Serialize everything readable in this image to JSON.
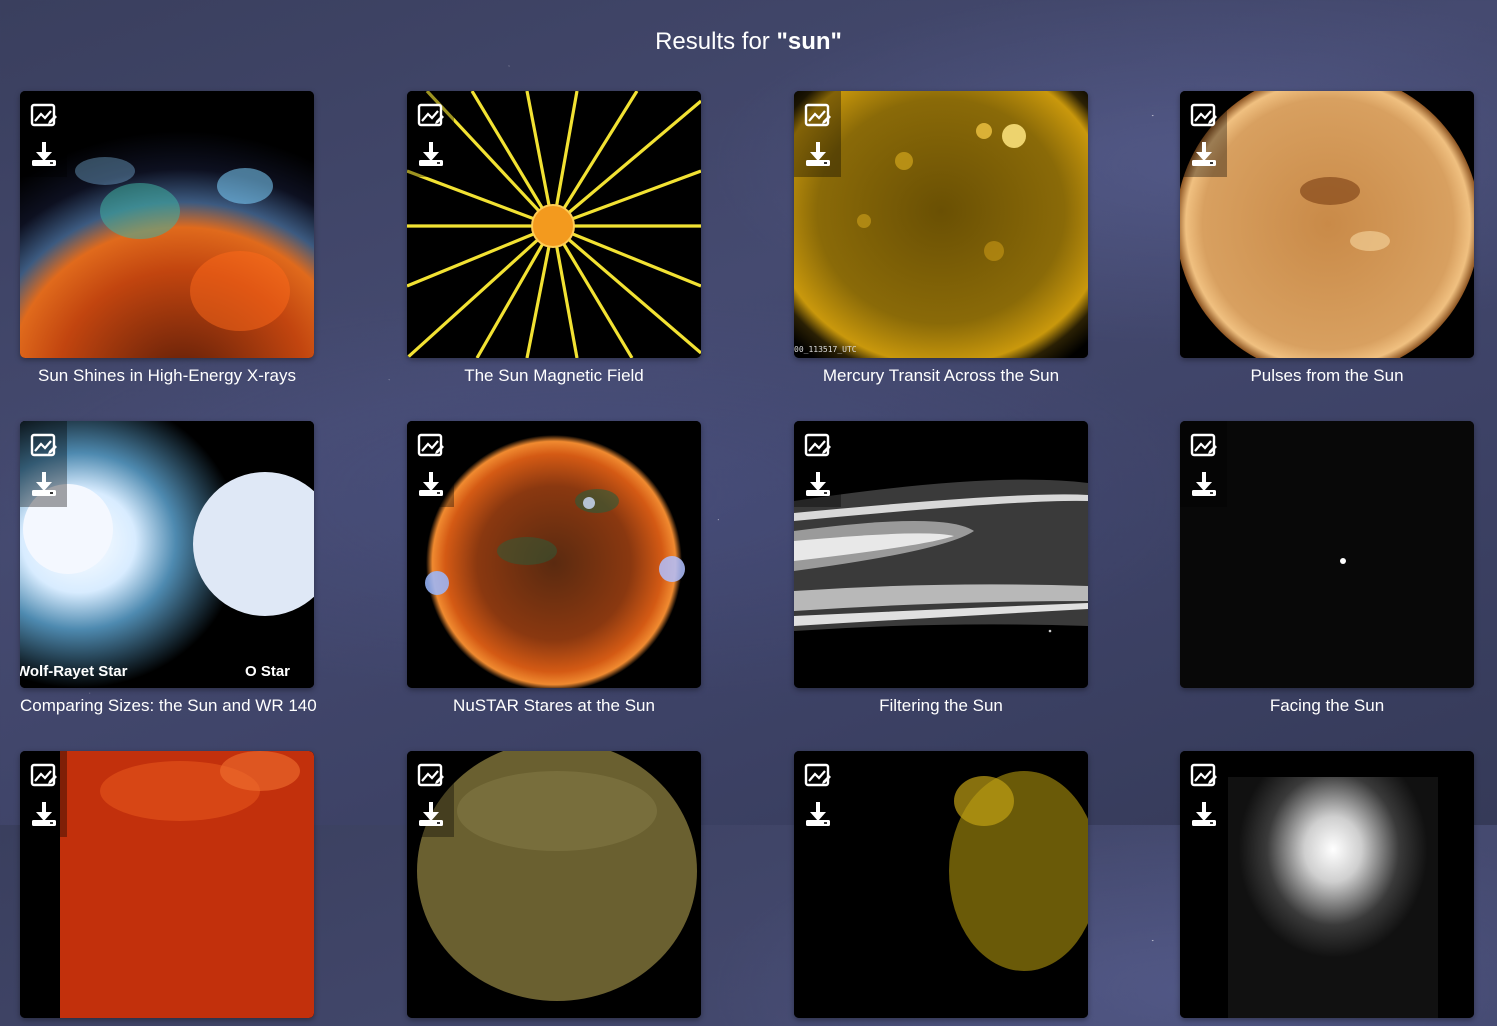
{
  "header": {
    "title_prefix": "Results for ",
    "query": "\"sun\""
  },
  "tool_labels": {
    "view": "",
    "download": ""
  },
  "results": [
    {
      "caption": "Sun Shines in High-Energy X-rays"
    },
    {
      "caption": "The Sun Magnetic Field"
    },
    {
      "caption": "Mercury Transit Across the Sun",
      "overlay": "00_113517_UTC"
    },
    {
      "caption": "Pulses from the Sun"
    },
    {
      "caption": "Comparing Sizes: the Sun and WR 140",
      "overlay_left": "Wolf-Rayet Star",
      "overlay_right": "O Star"
    },
    {
      "caption": "NuSTAR Stares at the Sun"
    },
    {
      "caption": "Filtering the Sun"
    },
    {
      "caption": "Facing the Sun"
    },
    {
      "caption": ""
    },
    {
      "caption": ""
    },
    {
      "caption": ""
    },
    {
      "caption": ""
    }
  ],
  "colors": {
    "background": "#3f4466",
    "caption_text": "#ffffff",
    "icon": "#ffffff"
  }
}
